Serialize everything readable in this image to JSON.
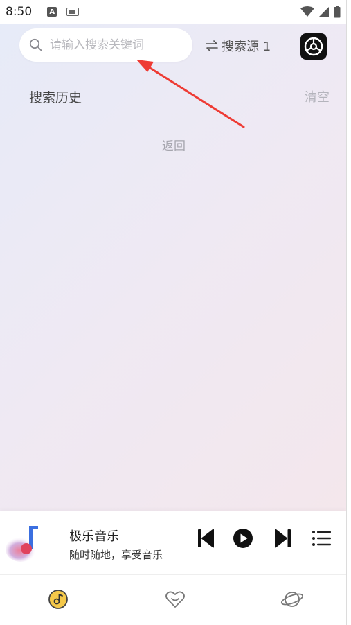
{
  "status_bar": {
    "time": "8:50",
    "notification_letter": "A",
    "icons": [
      "a-notification-icon",
      "keyboard-icon",
      "wifi-icon",
      "signal-icon",
      "battery-icon"
    ]
  },
  "search": {
    "placeholder": "请输入搜索关键词",
    "value": "",
    "source_label": "搜索源 1"
  },
  "history": {
    "title": "搜索历史",
    "clear_label": "清空",
    "back_label": "返回"
  },
  "player": {
    "title": "极乐音乐",
    "subtitle": "随时随地，享受音乐"
  },
  "nav": {
    "items": [
      "music-nav-icon",
      "favorites-nav-icon",
      "discover-nav-icon"
    ]
  },
  "colors": {
    "annotation_arrow": "#ee3b34",
    "placeholder": "#b8b8bd",
    "clear_text": "#b4b4bc",
    "music_nav_accent": "#f4c84a"
  }
}
